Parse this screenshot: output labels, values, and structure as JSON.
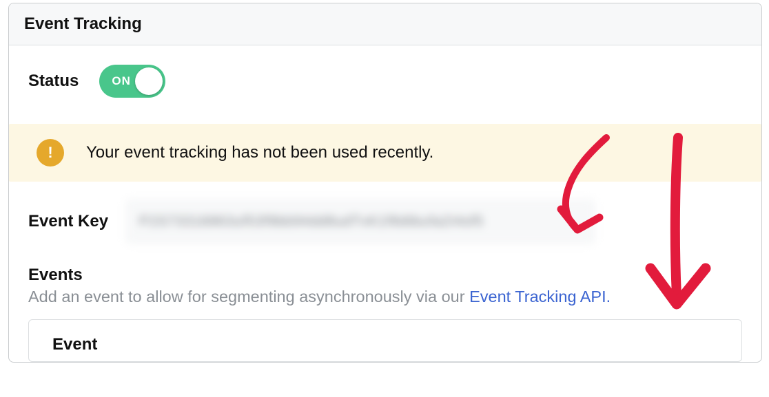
{
  "panel": {
    "title": "Event Tracking"
  },
  "status": {
    "label": "Status",
    "toggle_text": "ON",
    "toggle_state": "on"
  },
  "notice": {
    "icon_glyph": "!",
    "text": "Your event tracking has not been used recently."
  },
  "event_key": {
    "label": "Event Key",
    "value_masked": "P2S73316863uf53f9bb94dd8udTvK1f8dtbufa2I4sf5"
  },
  "events": {
    "title": "Events",
    "desc_prefix": "Add an event to allow for segmenting asynchronously via our ",
    "link_text": "Event Tracking API",
    "desc_suffix": "."
  },
  "subpanel": {
    "column_header": "Event"
  },
  "colors": {
    "toggle_on": "#49c68b",
    "notice_bg": "#fdf7e3",
    "notice_icon": "#e5a82b",
    "link": "#3b64d1",
    "annotation": "#e21b3c"
  }
}
